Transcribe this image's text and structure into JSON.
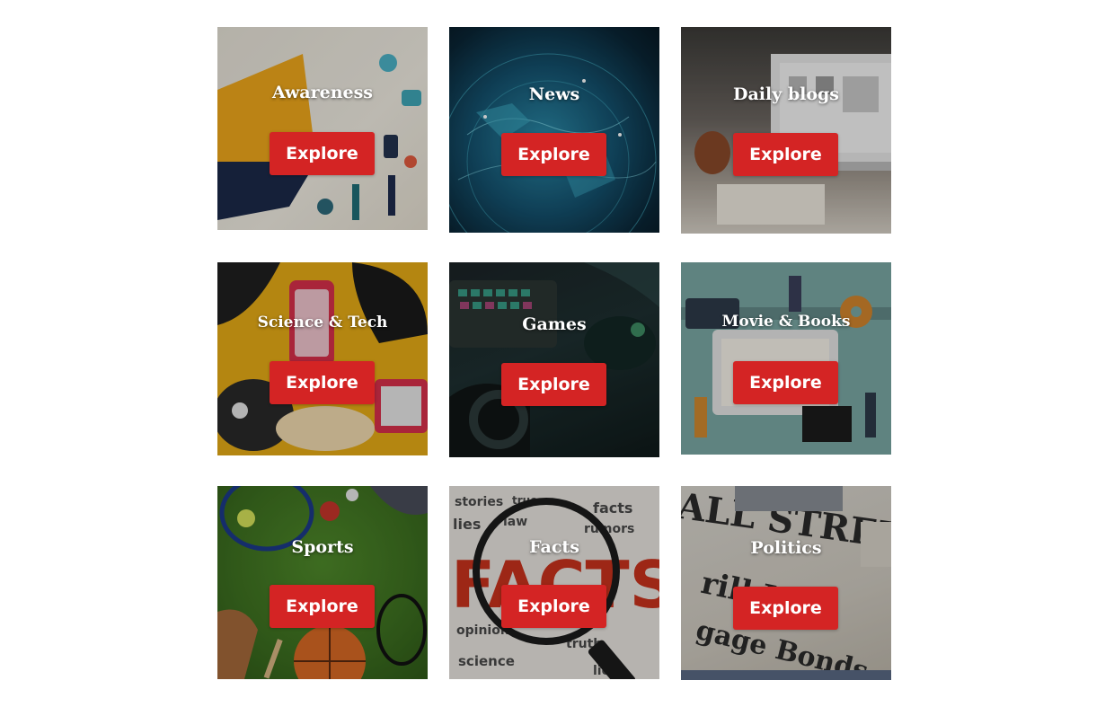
{
  "cards": [
    {
      "title": "Awareness",
      "button": "Explore"
    },
    {
      "title": "News",
      "button": "Explore"
    },
    {
      "title": "Daily blogs",
      "button": "Explore"
    },
    {
      "title": "Science & Tech",
      "button": "Explore"
    },
    {
      "title": "Games",
      "button": "Explore"
    },
    {
      "title": "Movie & Books",
      "button": "Explore"
    },
    {
      "title": "Sports",
      "button": "Explore"
    },
    {
      "title": "Facts",
      "button": "Explore"
    },
    {
      "title": "Politics",
      "button": "Explore"
    }
  ],
  "colors": {
    "button_bg": "#d42424",
    "button_text": "#ffffff",
    "title_text": "#ffffff"
  }
}
